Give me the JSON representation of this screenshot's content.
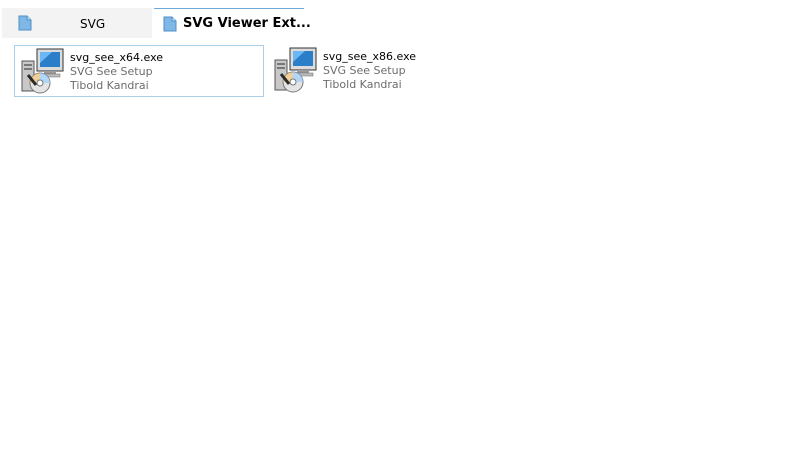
{
  "tabs": [
    {
      "label": "SVG",
      "active": false
    },
    {
      "label": "SVG Viewer Ext...",
      "active": true
    }
  ],
  "files": [
    {
      "name": "svg_see_x64.exe",
      "description": "SVG See Setup",
      "author": "Tibold Kandrai",
      "selected": true,
      "icon": "installer-icon"
    },
    {
      "name": "svg_see_x86.exe",
      "description": "SVG See Setup",
      "author": "Tibold Kandrai",
      "selected": false,
      "icon": "installer-icon"
    }
  ],
  "colors": {
    "tab_accent": "#6fa7d6",
    "selection_border": "#a9cfe8",
    "folder": "#7fb8e6"
  }
}
